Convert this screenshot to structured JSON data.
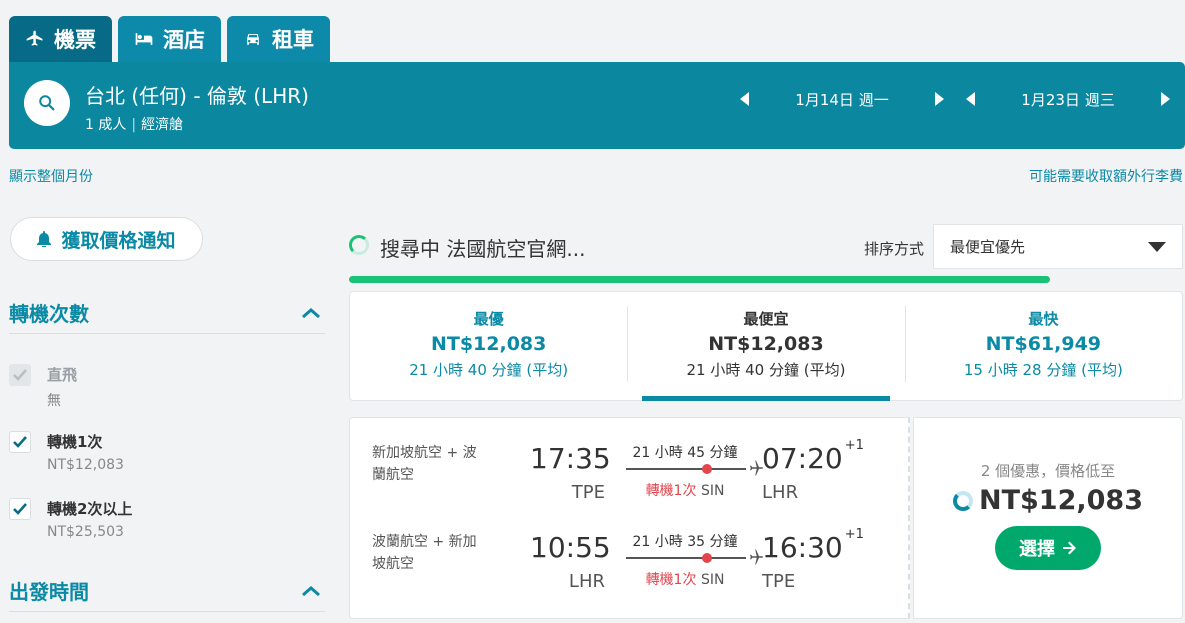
{
  "tabs": [
    {
      "label": "機票",
      "icon": "plane-icon"
    },
    {
      "label": "酒店",
      "icon": "bed-icon"
    },
    {
      "label": "租車",
      "icon": "car-icon"
    }
  ],
  "search": {
    "route": "台北 (任何) - 倫敦 (LHR)",
    "passengers": "1 成人",
    "cabin": "經濟艙",
    "depart_date": "1月14日 週一",
    "return_date": "1月23日 週三"
  },
  "links": {
    "show_month": "顯示整個月份",
    "baggage_fees": "可能需要收取額外行李費"
  },
  "sidebar": {
    "price_alert": "獲取價格通知",
    "stops_title": "轉機次數",
    "filters": [
      {
        "label": "直飛",
        "price": "無",
        "checked": true,
        "disabled": true
      },
      {
        "label": "轉機1次",
        "price": "NT$12,083",
        "checked": true,
        "disabled": false
      },
      {
        "label": "轉機2次以上",
        "price": "NT$25,503",
        "checked": true,
        "disabled": false
      }
    ],
    "departure_title": "出發時間"
  },
  "status": {
    "searching_text": "搜尋中 法國航空官網...",
    "progress": 0.84
  },
  "sort": {
    "label": "排序方式",
    "selected": "最便宜優先"
  },
  "summary": [
    {
      "title": "最優",
      "price": "NT$12,083",
      "duration": "21 小時 40 分鐘 (平均)",
      "active": false
    },
    {
      "title": "最便宜",
      "price": "NT$12,083",
      "duration": "21 小時 40 分鐘 (平均)",
      "active": true
    },
    {
      "title": "最快",
      "price": "NT$61,949",
      "duration": "15 小時 28 分鐘 (平均)",
      "active": false
    }
  ],
  "result": {
    "legs": [
      {
        "airline": "新加坡航空 + 波蘭航空",
        "dep_time": "17:35",
        "dep_code": "TPE",
        "duration": "21 小時 45 分鐘",
        "stops": "轉機1次",
        "via": "SIN",
        "arr_time": "07:20",
        "day_offset": "+1",
        "arr_code": "LHR"
      },
      {
        "airline": "波蘭航空 + 新加坡航空",
        "dep_time": "10:55",
        "dep_code": "LHR",
        "duration": "21 小時 35 分鐘",
        "stops": "轉機1次",
        "via": "SIN",
        "arr_time": "16:30",
        "day_offset": "+1",
        "arr_code": "TPE"
      }
    ],
    "deals_text": "2 個優惠，價格低至",
    "price": "NT$12,083",
    "select_label": "選擇"
  },
  "colors": {
    "brand": "#0b879f",
    "accent_green": "#00a86b",
    "stop_red": "#e3454d"
  }
}
